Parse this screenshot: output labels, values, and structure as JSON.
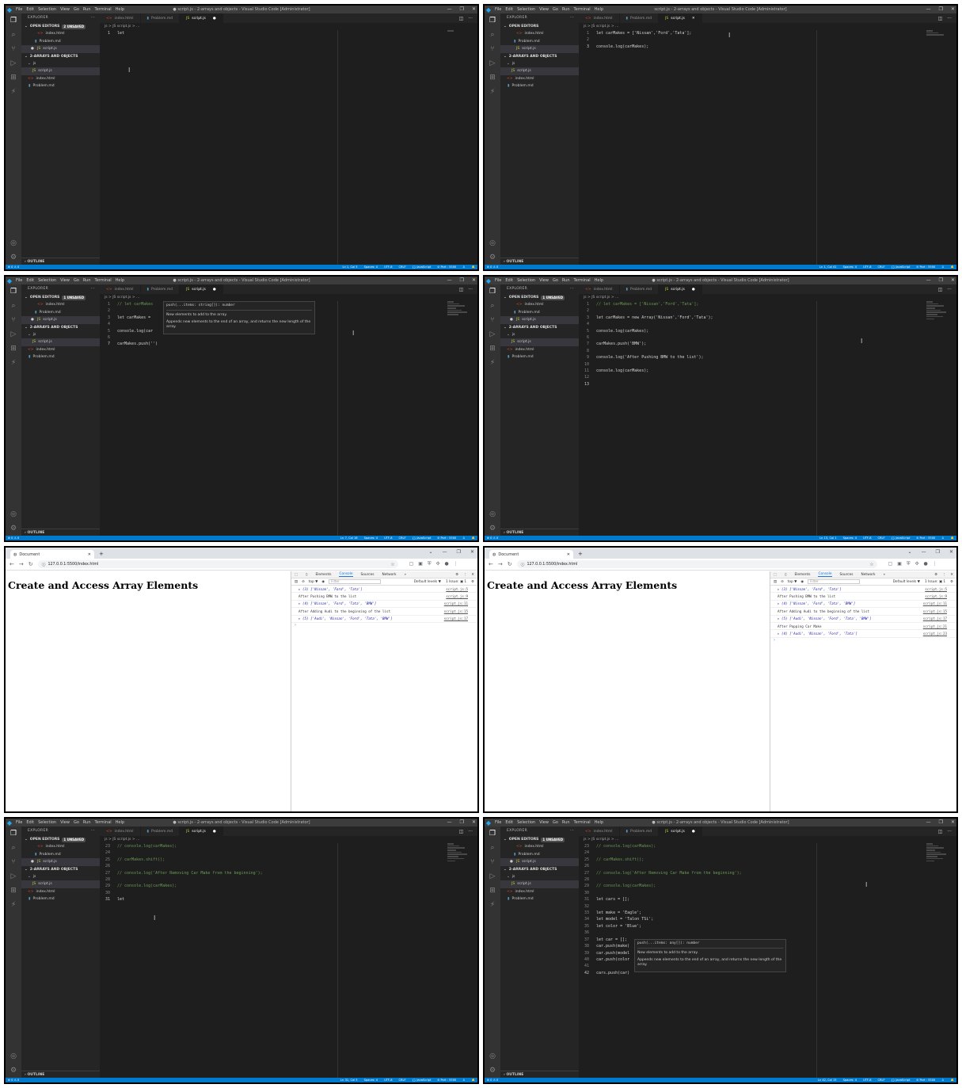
{
  "vscode": {
    "menu": [
      "File",
      "Edit",
      "Selection",
      "View",
      "Go",
      "Run",
      "Terminal",
      "Help"
    ],
    "explorer_label": "EXPLORER",
    "open_editors_label": "OPEN EDITORS",
    "folder_label": "2-ARRAYS AND OBJECTS",
    "js_folder": "js",
    "outline_label": "OUTLINE",
    "files": {
      "html": "index.html",
      "md": "Problem.md",
      "js": "script.js"
    },
    "breadcrumb": "js > JS script.js > ...",
    "window_controls": [
      "—",
      "❐",
      "✕"
    ],
    "status_left": "⊗ 0 ⚠ 0",
    "status_right": [
      "Spaces: 4",
      "UTF-8",
      "CRLF",
      "{} JavaScript",
      "⊘ Port : 5500",
      "♙",
      "🔔"
    ]
  },
  "vscode_panels": [
    {
      "title": "● script.js - 2-arrays and objects - Visual Studio Code [Administrator]",
      "unsaved": "2 UNSAVED",
      "tab_dirty": true,
      "cursor_pos": "Ln 1, Col 5",
      "lines": [
        {
          "n": "1",
          "t": "let "
        }
      ],
      "hover": null
    },
    {
      "title": "script.js - 2-arrays and objects - Visual Studio Code [Administrator]",
      "unsaved": "",
      "tab_dirty": false,
      "cursor_pos": "Ln 1, Col 41",
      "lines": [
        {
          "n": "1",
          "t": "let carMakes = ['Nissan','Ford','Tata'];"
        },
        {
          "n": "2",
          "t": ""
        },
        {
          "n": "3",
          "t": "console.log(carMakes);"
        }
      ],
      "hover": null
    },
    {
      "title": "● script.js - 2-arrays and objects - Visual Studio Code [Administrator]",
      "unsaved": "1 UNSAVED",
      "tab_dirty": true,
      "cursor_pos": "Ln 7, Col 16",
      "lines": [
        {
          "n": "1",
          "t": "// let carMakes"
        },
        {
          "n": "2",
          "t": ""
        },
        {
          "n": "3",
          "t": "let carMakes ="
        },
        {
          "n": "4",
          "t": ""
        },
        {
          "n": "5",
          "t": "console.log(car"
        },
        {
          "n": "6",
          "t": ""
        },
        {
          "n": "7",
          "t": "carMakes.push('')"
        }
      ],
      "hover": {
        "sig": "push(...items: string[]): number",
        "p1": "New elements to add to the array.",
        "p2": "Appends new elements to the end of an array, and returns the new length of the array."
      }
    },
    {
      "title": "● script.js - 2-arrays and objects - Visual Studio Code [Administrator]",
      "unsaved": "1 UNSAVED",
      "tab_dirty": true,
      "cursor_pos": "Ln 13, Col 1",
      "lines": [
        {
          "n": "1",
          "t": "// let carMakes = ['Nissan','Ford','Tata'];"
        },
        {
          "n": "2",
          "t": ""
        },
        {
          "n": "3",
          "t": "let carMakes = new Array('Nissan','Ford','Tata');"
        },
        {
          "n": "4",
          "t": ""
        },
        {
          "n": "5",
          "t": "console.log(carMakes);"
        },
        {
          "n": "6",
          "t": ""
        },
        {
          "n": "7",
          "t": "carMakes.push('BMW');"
        },
        {
          "n": "8",
          "t": ""
        },
        {
          "n": "9",
          "t": "console.log('After Pushing BMW to the list');"
        },
        {
          "n": "10",
          "t": ""
        },
        {
          "n": "11",
          "t": "console.log(carMakes);"
        },
        {
          "n": "12",
          "t": ""
        },
        {
          "n": "13",
          "t": ""
        }
      ],
      "hover": null
    },
    {
      "title": "● script.js - 2-arrays and objects - Visual Studio Code [Administrator]",
      "unsaved": "1 UNSAVED",
      "tab_dirty": true,
      "cursor_pos": "Ln 31, Col 5",
      "lines": [
        {
          "n": "23",
          "t": "// console.log(carMakes);"
        },
        {
          "n": "24",
          "t": ""
        },
        {
          "n": "25",
          "t": "// carMakes.shift();"
        },
        {
          "n": "26",
          "t": ""
        },
        {
          "n": "27",
          "t": "// console.log('After Removing Car Make from the beginning');"
        },
        {
          "n": "28",
          "t": ""
        },
        {
          "n": "29",
          "t": "// console.log(carMakes);"
        },
        {
          "n": "30",
          "t": ""
        },
        {
          "n": "31",
          "t": "let "
        }
      ],
      "hover": null
    },
    {
      "title": "● script.js - 2-arrays and objects - Visual Studio Code [Administrator]",
      "unsaved": "1 UNSAVED",
      "tab_dirty": true,
      "cursor_pos": "Ln 42, Col 15",
      "lines": [
        {
          "n": "23",
          "t": "// console.log(carMakes);"
        },
        {
          "n": "24",
          "t": ""
        },
        {
          "n": "25",
          "t": "// carMakes.shift();"
        },
        {
          "n": "26",
          "t": ""
        },
        {
          "n": "27",
          "t": "// console.log('After Removing Car Make from the beginning');"
        },
        {
          "n": "28",
          "t": ""
        },
        {
          "n": "29",
          "t": "// console.log(carMakes);"
        },
        {
          "n": "30",
          "t": ""
        },
        {
          "n": "31",
          "t": "let cars = [];"
        },
        {
          "n": "32",
          "t": ""
        },
        {
          "n": "33",
          "t": "let make = 'Eagle';"
        },
        {
          "n": "34",
          "t": "let model = 'Talon TSi';"
        },
        {
          "n": "35",
          "t": "let color = 'Blue';"
        },
        {
          "n": "36",
          "t": ""
        },
        {
          "n": "37",
          "t": "let car = [];"
        },
        {
          "n": "38",
          "t": "car.push(make)"
        },
        {
          "n": "39",
          "t": "car.push(model"
        },
        {
          "n": "40",
          "t": "car.push(color"
        },
        {
          "n": "41",
          "t": ""
        },
        {
          "n": "42",
          "t": "cars.push(car)"
        }
      ],
      "hover": {
        "sig": "push(...items: any[]): number",
        "p1": "New elements to add to the array.",
        "p2": "Appends new elements to the end of an array, and returns the new length of the array."
      }
    }
  ],
  "browser": {
    "tab_title": "Document",
    "url": "127.0.0.1:5500/index.html",
    "heading": "Create and Access Array Elements",
    "devtools_tabs": [
      "Elements",
      "Console",
      "Sources",
      "Network",
      "»"
    ],
    "context": "top ▼",
    "filter_placeholder": "Filter",
    "levels": "Default levels ▼",
    "issues": "1 Issue: ▣ 1"
  },
  "browser_panels": [
    {
      "logs": [
        {
          "text": "▸ (3) ['Nissan', 'Ford', 'Tata']",
          "src": "script.js:5",
          "arr": true
        },
        {
          "text": "After Pushing BMW to the list",
          "src": "script.js:9",
          "arr": false
        },
        {
          "text": "▸ (4) ['Nissan', 'Ford', 'Tata', 'BMW']",
          "src": "script.js:11",
          "arr": true
        },
        {
          "text": "After Adding Audi to the beginning of the list",
          "src": "script.js:15",
          "arr": false
        },
        {
          "text": "▸ (5) ['Audi', 'Nissan', 'Ford', 'Tata', 'BMW']",
          "src": "script.js:17",
          "arr": true
        }
      ]
    },
    {
      "logs": [
        {
          "text": "▸ (3) ['Nissan', 'Ford', 'Tata']",
          "src": "script.js:5",
          "arr": true
        },
        {
          "text": "After Pushing BMW to the list",
          "src": "script.js:9",
          "arr": false
        },
        {
          "text": "▸ (4) ['Nissan', 'Ford', 'Tata', 'BMW']",
          "src": "script.js:11",
          "arr": true
        },
        {
          "text": "After Adding Audi to the beginning of the list",
          "src": "script.js:15",
          "arr": false
        },
        {
          "text": "▸ (5) ['Audi', 'Nissan', 'Ford', 'Tata', 'BMW']",
          "src": "script.js:17",
          "arr": true
        },
        {
          "text": "After Popping Car Make",
          "src": "script.js:21",
          "arr": false
        },
        {
          "text": "▸ (4) ['Audi', 'Nissan', 'Ford', 'Tata']",
          "src": "script.js:23",
          "arr": true
        }
      ]
    }
  ]
}
